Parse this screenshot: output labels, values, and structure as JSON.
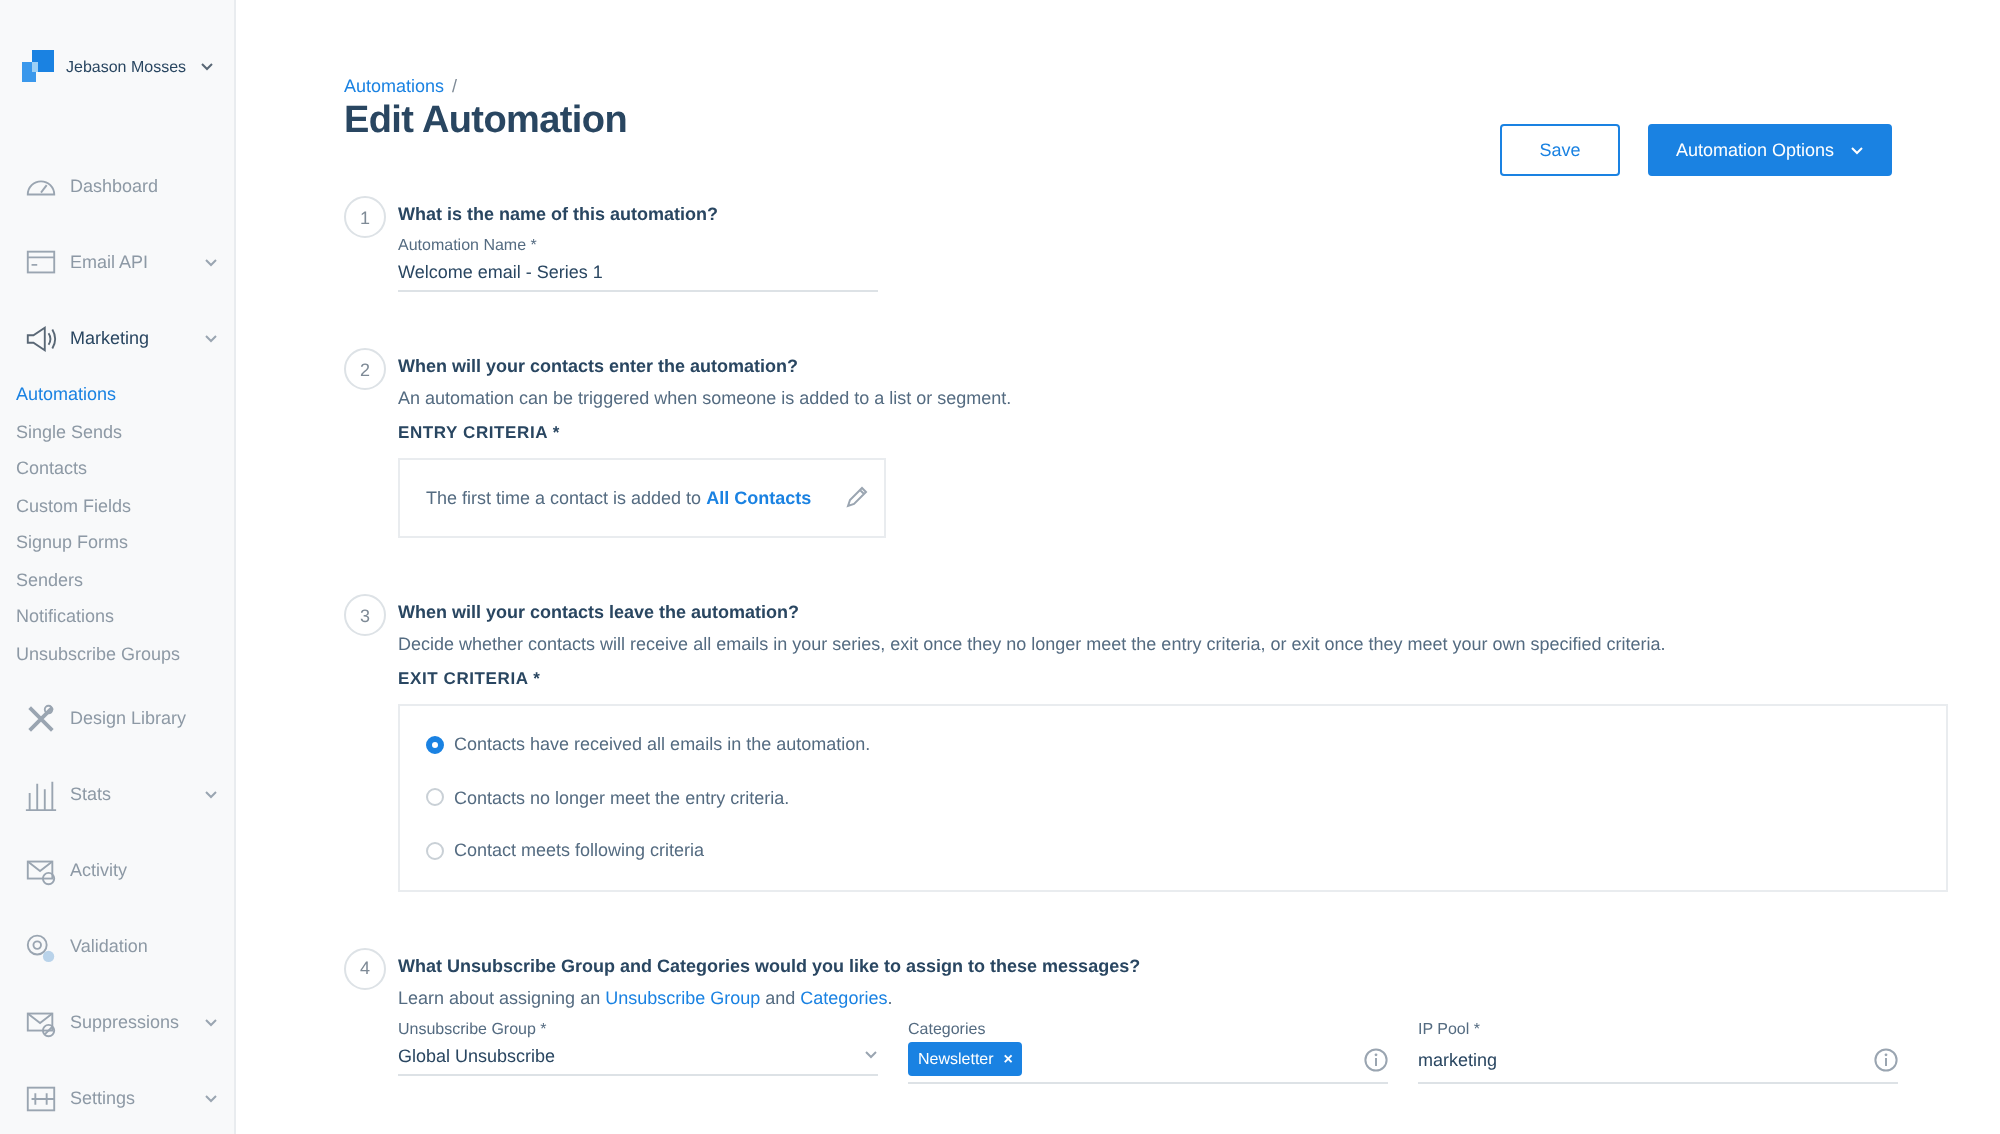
{
  "account": {
    "name": "Jebason Mosses",
    "expandable": true
  },
  "nav": [
    {
      "label": "Dashboard",
      "expandable": false
    },
    {
      "label": "Email API",
      "expandable": true
    },
    {
      "label": "Marketing",
      "expandable": true,
      "children": [
        {
          "label": "Automations",
          "selected": true
        },
        {
          "label": "Single Sends",
          "selected": false
        },
        {
          "label": "Contacts",
          "selected": false
        },
        {
          "label": "Custom Fields",
          "selected": false
        },
        {
          "label": "Signup Forms",
          "selected": false
        },
        {
          "label": "Senders",
          "selected": false
        },
        {
          "label": "Notifications",
          "selected": false
        },
        {
          "label": "Unsubscribe Groups",
          "selected": false
        }
      ]
    },
    {
      "label": "Design Library",
      "expandable": false
    },
    {
      "label": "Stats",
      "expandable": true
    },
    {
      "label": "Activity",
      "expandable": false
    },
    {
      "label": "Validation",
      "expandable": false
    },
    {
      "label": "Suppressions",
      "expandable": true
    },
    {
      "label": "Settings",
      "expandable": true
    }
  ],
  "breadcrumb": {
    "link": "Automations",
    "separator": "/"
  },
  "title": "Edit Automation",
  "buttons": [
    {
      "label": "Save",
      "kind": "secondary"
    },
    {
      "label": "Automation Options",
      "kind": "primary"
    }
  ],
  "steps": [
    {
      "kind": "name",
      "number": "1",
      "question": "What is the name of this automation?",
      "field": {
        "label": "Automation Name *",
        "value": "Welcome email - Series 1"
      }
    },
    {
      "kind": "entry",
      "number": "2",
      "question": "When will your contacts enter the automation?",
      "description": "An automation can be triggered when someone is added to a list or segment.",
      "criteria_label": "ENTRY CRITERIA *",
      "criteria_text": "The first time a contact is added to ",
      "criteria_link": "All Contacts"
    },
    {
      "kind": "exit",
      "number": "3",
      "question": "When will your contacts leave the automation?",
      "description": "Decide whether contacts will receive all emails in your series, exit once they no longer meet the entry criteria, or exit once they meet your own specified criteria.",
      "criteria_label": "EXIT CRITERIA *",
      "options": [
        {
          "label": "Contacts have received all emails in the automation.",
          "selected": true
        },
        {
          "label": "Contacts no longer meet the entry criteria.",
          "selected": false
        },
        {
          "label": "Contact meets following criteria",
          "selected": false
        }
      ]
    },
    {
      "kind": "groups",
      "number": "4",
      "question": "What Unsubscribe Group and Categories would you like to assign to these messages?",
      "description": [
        {
          "text": "Learn about assigning an "
        },
        {
          "link": "Unsubscribe Group"
        },
        {
          "text": " and "
        },
        {
          "link": "Categories"
        },
        {
          "text": "."
        }
      ],
      "fields": [
        {
          "kind": "select",
          "label": "Unsubscribe Group *",
          "value": "Global Unsubscribe"
        },
        {
          "kind": "tags",
          "label": "Categories",
          "tags": [
            {
              "label": "Newsletter",
              "remove": "×"
            }
          ]
        },
        {
          "kind": "text",
          "label": "IP Pool *",
          "value": "marketing"
        }
      ]
    }
  ]
}
